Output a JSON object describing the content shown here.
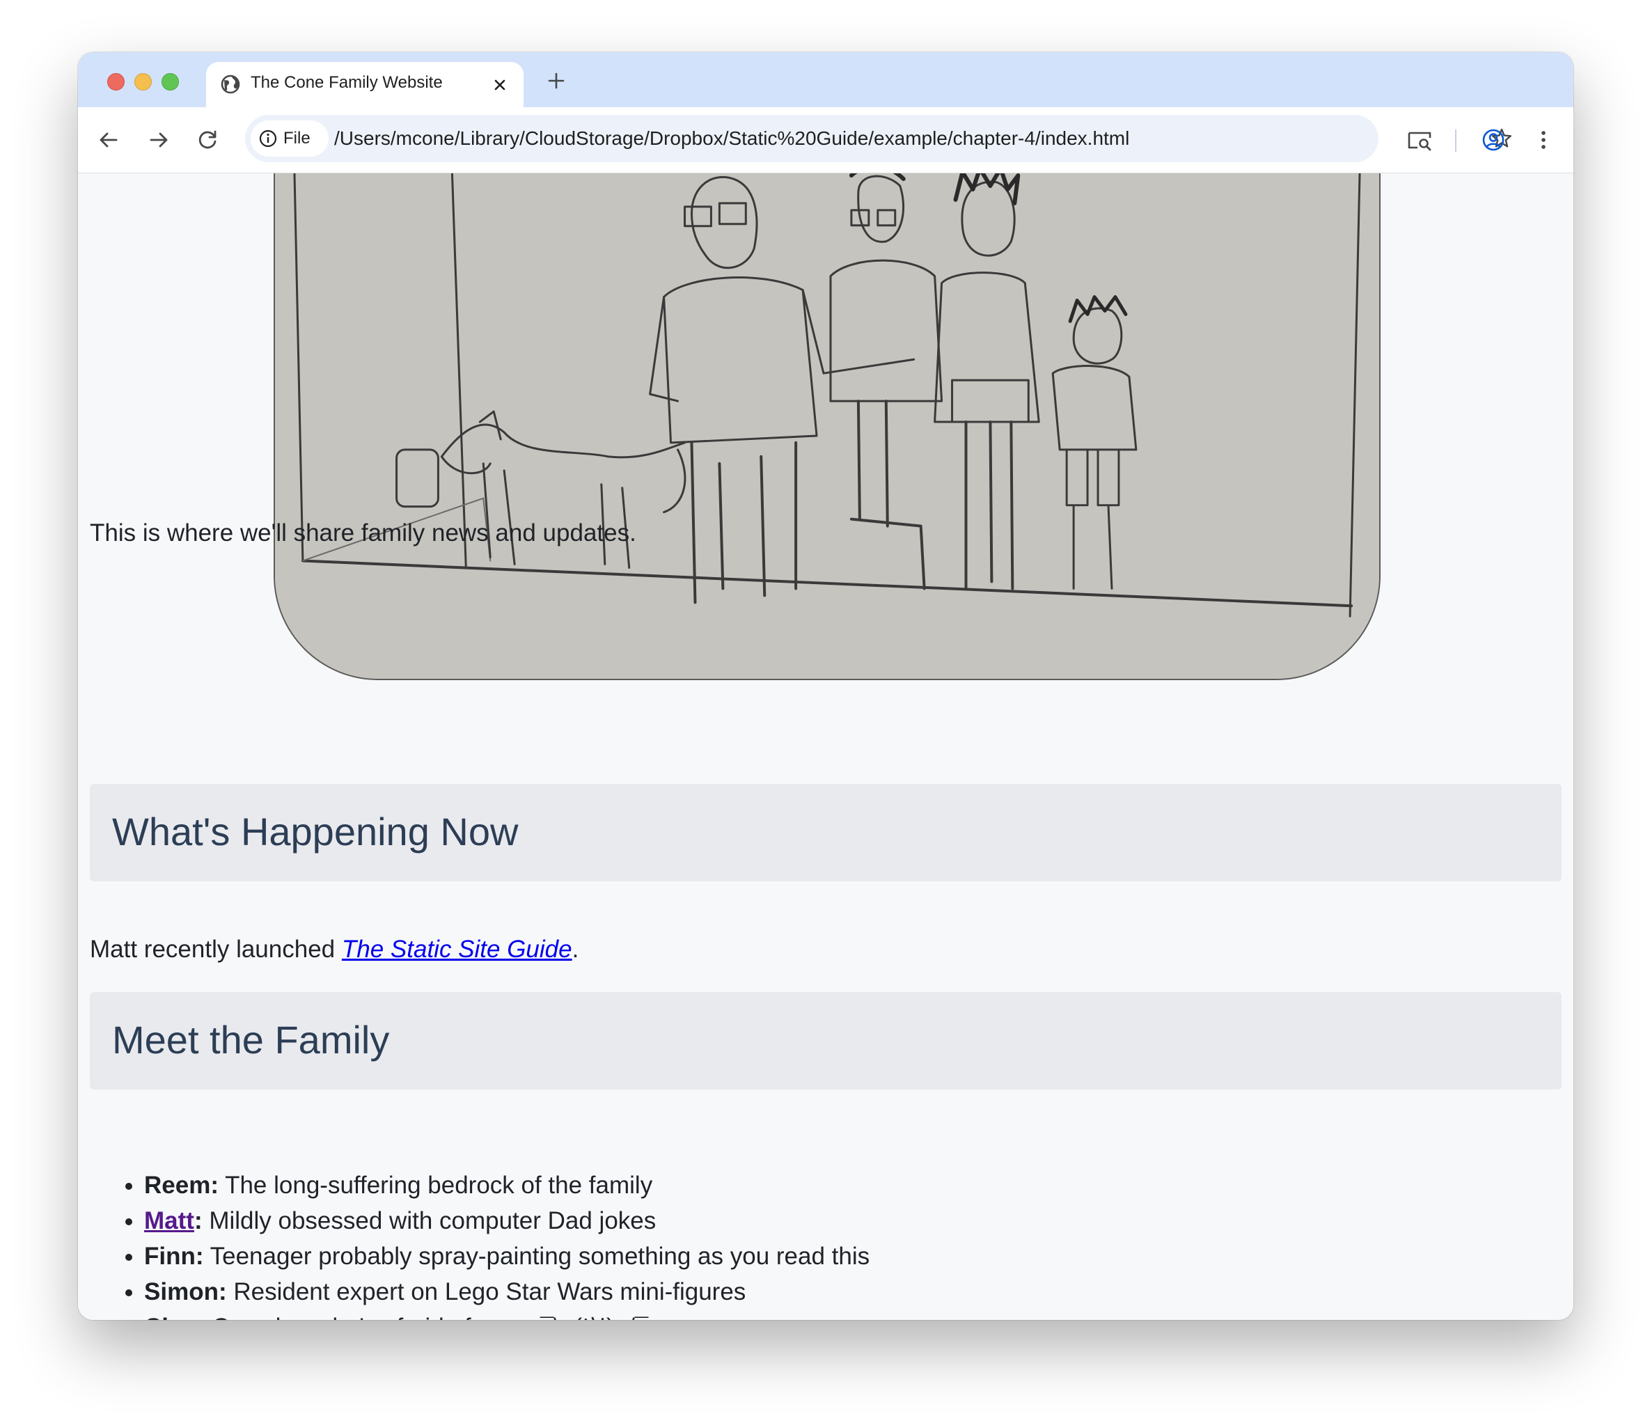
{
  "browser": {
    "tab_title": "The Cone Family Website",
    "chip_label": "File",
    "url": "/Users/mcone/Library/CloudStorage/Dropbox/Static%20Guide/example/chapter-4/index.html"
  },
  "page": {
    "intro": "This is where we'll share family news and updates.",
    "sections": {
      "happening": {
        "heading": "What's Happening Now",
        "text_before": "Matt recently launched ",
        "link_text": "The Static Site Guide",
        "text_after": "."
      },
      "family": {
        "heading": "Meet the Family",
        "members": [
          {
            "name": "Reem:",
            "desc": " The long-suffering bedrock of the family"
          },
          {
            "name": "Matt",
            "sep": ":",
            "desc": " Mildly obsessed with computer Dad jokes"
          },
          {
            "name": "Finn:",
            "desc": " Teenager probably spray-painting something as you read this"
          },
          {
            "name": "Simon:",
            "desc": " Resident expert on Lego Star Wars mini-figures"
          },
          {
            "name": "Cleo:",
            "desc": " Cow dog who's afraid of cows ¯\\_(ツ)_/¯"
          }
        ]
      }
    }
  },
  "colors": {
    "tabstrip": "#d3e2fb",
    "link": "#0000ee",
    "visited_link": "#551a8b",
    "heading_text": "#2c3e55",
    "section_bg": "#e9eaee"
  },
  "icons": [
    "globe-icon",
    "close-icon",
    "plus-icon",
    "back-arrow-icon",
    "forward-arrow-icon",
    "reload-icon",
    "info-icon",
    "star-icon",
    "cast-search-icon",
    "profile-icon",
    "kebab-menu-icon"
  ]
}
